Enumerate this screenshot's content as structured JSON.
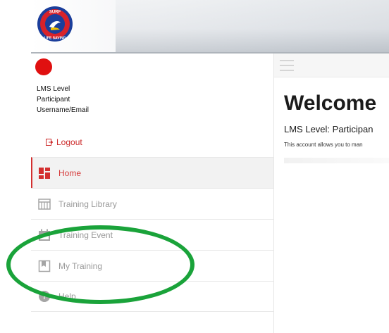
{
  "header": {
    "logo": {
      "icon": "surf-life-saving-logo",
      "text_top": "SURF",
      "text_bottom": "LIFE SAVING"
    }
  },
  "user": {
    "level": "LMS Level",
    "role": "Participant",
    "username": "Username/Email",
    "avatar_color": "#e01010"
  },
  "logout": {
    "label": "Logout",
    "icon": "logout-icon"
  },
  "nav": {
    "items": [
      {
        "label": "Home",
        "icon": "dashboard-icon",
        "active": true
      },
      {
        "label": "Training Library",
        "icon": "library-icon",
        "active": false
      },
      {
        "label": "Training Event",
        "icon": "calendar-icon",
        "active": false
      },
      {
        "label": "My Training",
        "icon": "bookmark-icon",
        "active": false
      },
      {
        "label": "Help",
        "icon": "help-icon",
        "active": false
      }
    ]
  },
  "main": {
    "welcome_title": "Welcome",
    "lms_level_line": "LMS Level: Participan",
    "account_line": "This account allows you to man"
  },
  "colors": {
    "accent": "#d32f2f",
    "annotation": "#1aa33a"
  }
}
